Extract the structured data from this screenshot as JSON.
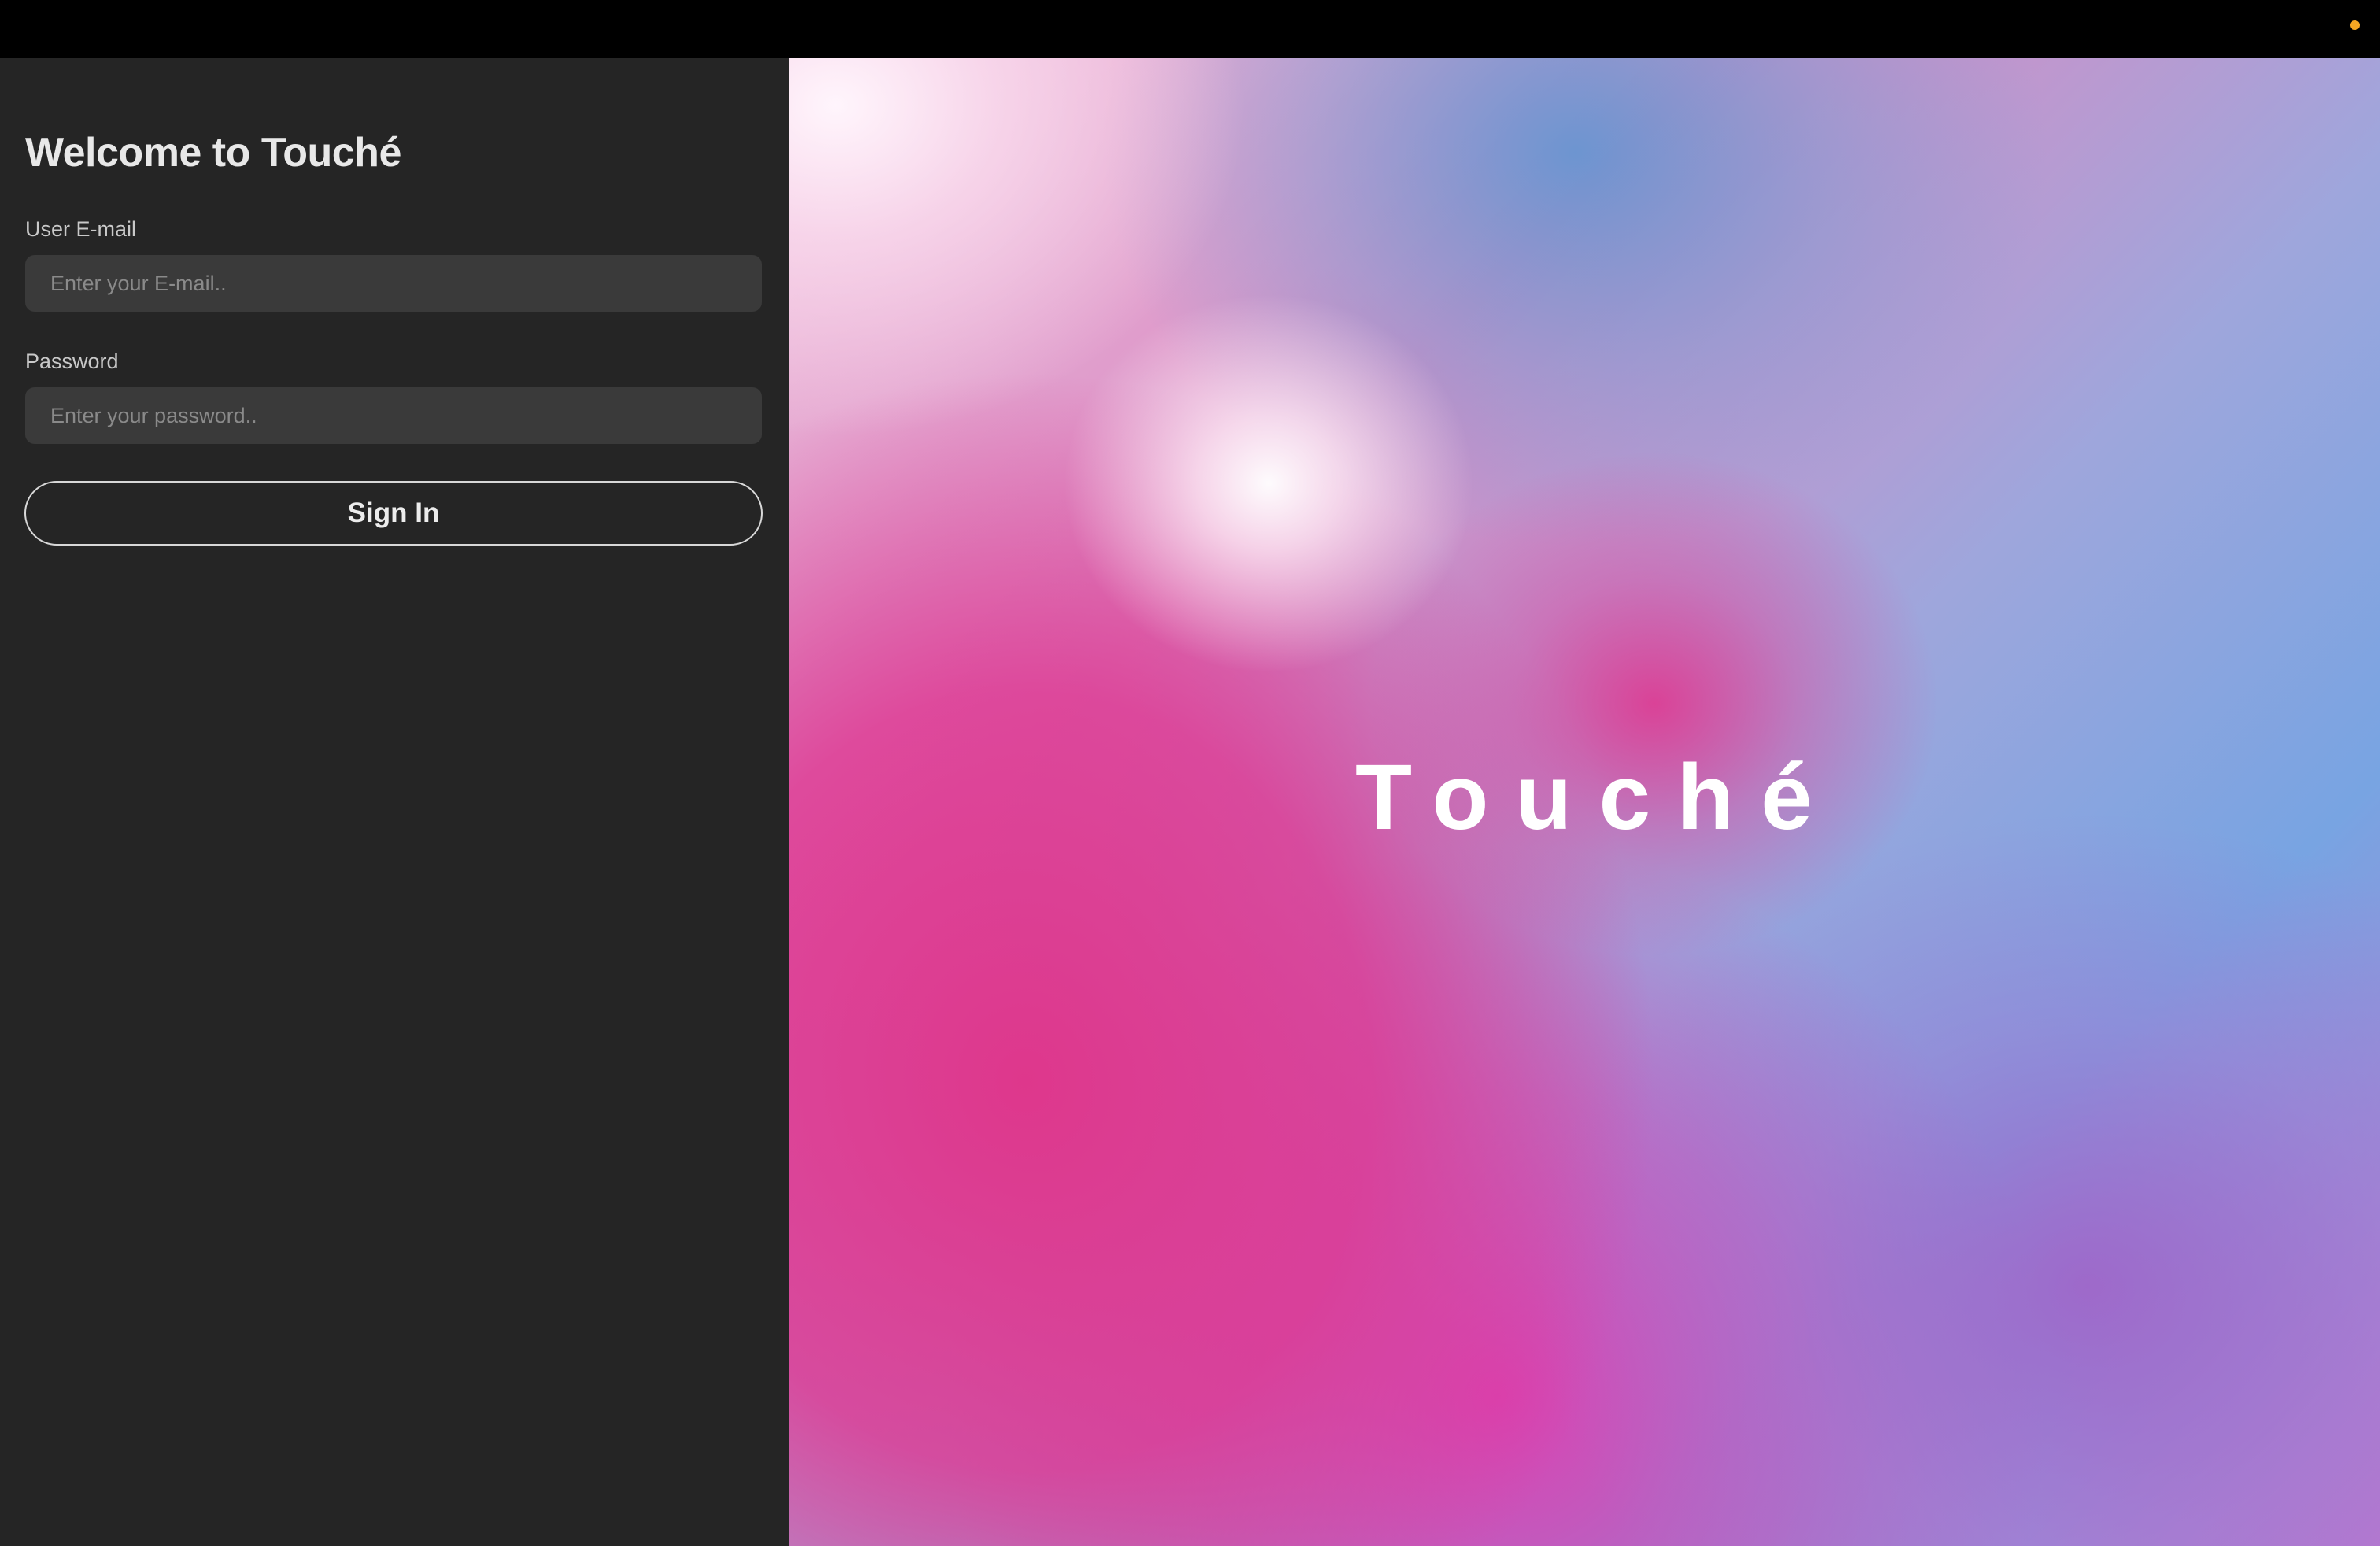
{
  "login": {
    "title": "Welcome to Touché",
    "email_label": "User E-mail",
    "email_placeholder": "Enter your E-mail..",
    "email_value": "",
    "password_label": "Password",
    "password_placeholder": "Enter your password..",
    "password_value": "",
    "signin_label": "Sign In"
  },
  "brand": {
    "word": "Touché"
  },
  "colors": {
    "status_dot": "#f5a623",
    "panel_background": "#252525",
    "input_background": "#3a3a3a",
    "accent_pink": "#e0368a",
    "accent_blue": "#6fa3de"
  }
}
